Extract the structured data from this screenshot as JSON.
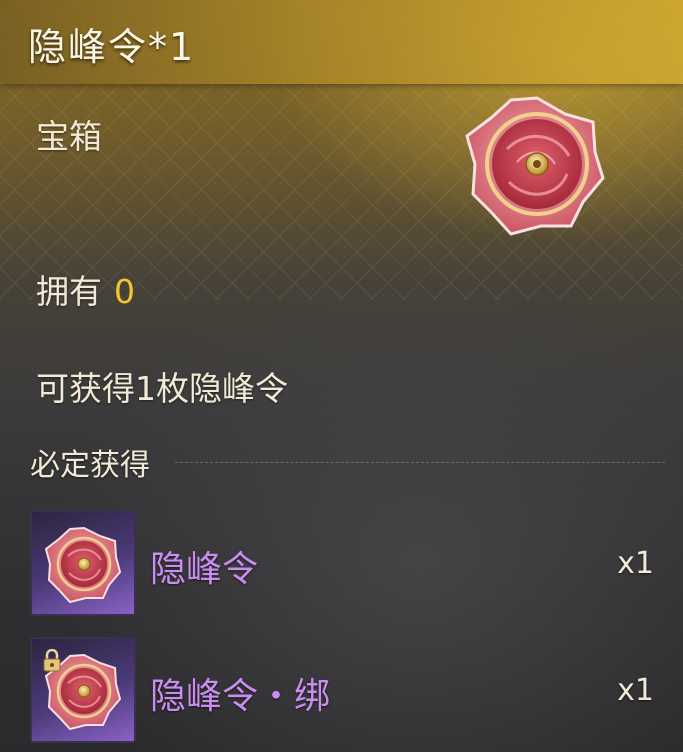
{
  "item": {
    "title": "隐峰令*1",
    "category": "宝箱",
    "icon": "red-flower-token-icon"
  },
  "owned": {
    "label": "拥有",
    "count": "0"
  },
  "description": "可获得1枚隐峰令",
  "guaranteed": {
    "section_title": "必定获得",
    "rewards": [
      {
        "name": "隐峰令",
        "quantity": "x1",
        "icon": "red-flower-token-icon",
        "bound": false
      },
      {
        "name": "隐峰令・绑",
        "quantity": "x1",
        "icon": "red-flower-token-icon",
        "bound": true
      }
    ]
  },
  "colors": {
    "reward_name": "#c98df0",
    "owned_count": "#f1c62e",
    "text": "#f2ead6"
  }
}
